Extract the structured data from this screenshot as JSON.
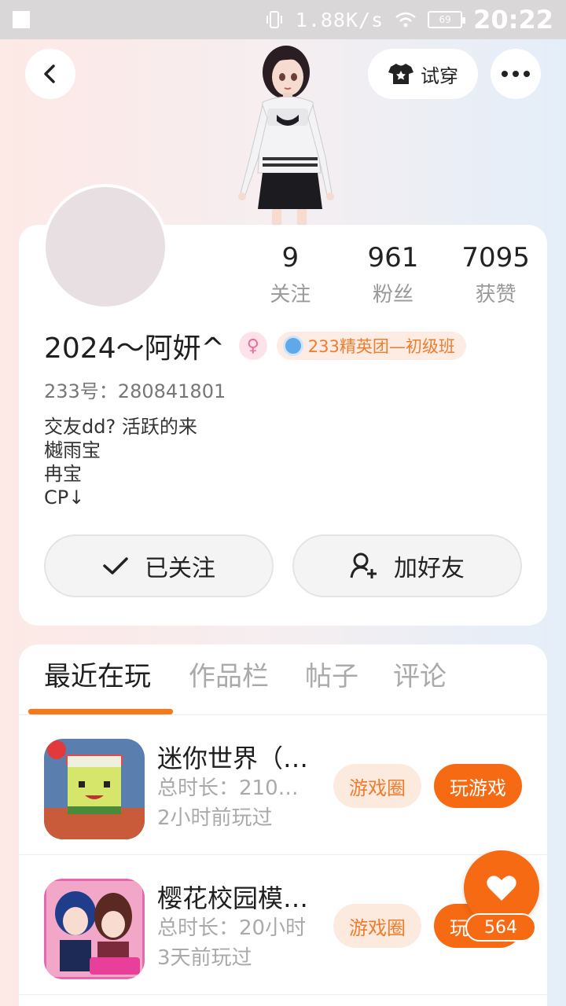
{
  "status_bar": {
    "speed": "1.88K/s",
    "battery": "69",
    "time": "20:22"
  },
  "header": {
    "try_on_label": "试穿"
  },
  "profile": {
    "stats": [
      {
        "num": "9",
        "label": "关注"
      },
      {
        "num": "961",
        "label": "粉丝"
      },
      {
        "num": "7095",
        "label": "获赞"
      }
    ],
    "name": "2024～阿妍^",
    "gender_symbol": "♀",
    "rank": "233精英团—初级班",
    "user_id": "233号：280841801",
    "bio": [
      "交友dd? 活跃的来",
      "樾雨宝",
      "冉宝",
      "CP↓"
    ],
    "follow_label": "已关注",
    "add_friend_label": "加好友"
  },
  "tabs": [
    "最近在玩",
    "作品栏",
    "帖子",
    "评论"
  ],
  "games": [
    {
      "title": "迷你世界（…",
      "duration": "总时长：210…",
      "last_played": "2小时前玩过",
      "circle_label": "游戏圈",
      "play_label": "玩游戏"
    },
    {
      "title": "樱花校园模…",
      "duration": "总时长：20小时",
      "last_played": "3天前玩过",
      "circle_label": "游戏圈",
      "play_label": "玩游戏"
    }
  ],
  "like": {
    "count": "564"
  },
  "colors": {
    "accent": "#f56a12",
    "accent_light": "#fdeade"
  }
}
